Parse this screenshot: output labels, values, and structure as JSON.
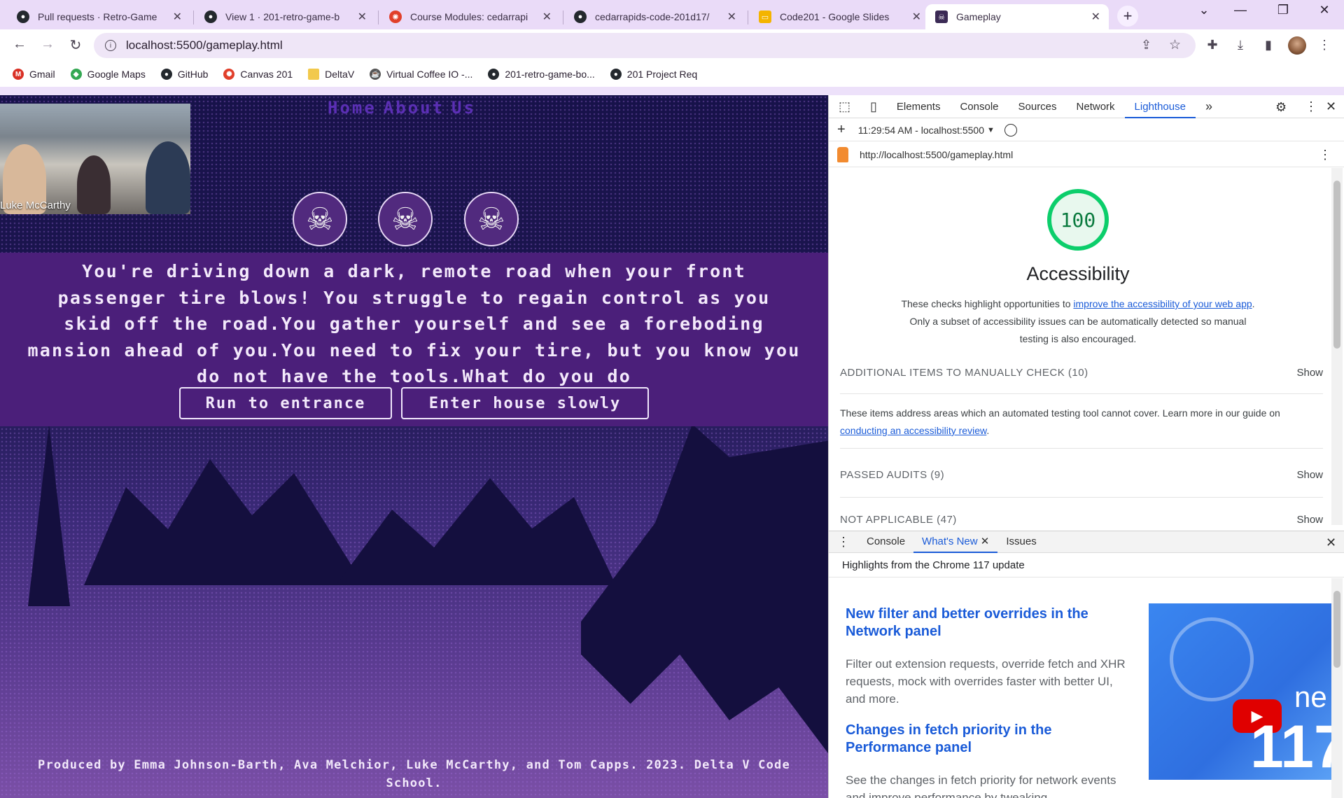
{
  "tabs": [
    {
      "title": "Pull requests · Retro-Game",
      "icon": "github-icon"
    },
    {
      "title": "View 1 · 201-retro-game-b",
      "icon": "github-icon"
    },
    {
      "title": "Course Modules: cedarrapi",
      "icon": "canvas-icon"
    },
    {
      "title": "cedarrapids-code-201d17/",
      "icon": "github-icon"
    },
    {
      "title": "Code201 - Google Slides",
      "icon": "slides-icon"
    },
    {
      "title": "Gameplay",
      "icon": "skull-icon"
    }
  ],
  "address_bar": {
    "url": "localhost:5500/gameplay.html"
  },
  "bookmarks": [
    {
      "label": "Gmail",
      "icon": "gmail-icon",
      "color": "#d93025"
    },
    {
      "label": "Google Maps",
      "icon": "maps-icon",
      "color": "#34a853"
    },
    {
      "label": "GitHub",
      "icon": "github-icon",
      "color": "#24292e"
    },
    {
      "label": "Canvas 201",
      "icon": "canvas-icon",
      "color": "#e13f2a"
    },
    {
      "label": "DeltaV",
      "icon": "folder-icon",
      "color": "#f2c94c"
    },
    {
      "label": "Virtual Coffee IO -...",
      "icon": "coffee-icon",
      "color": "#555555"
    },
    {
      "label": "201-retro-game-bo...",
      "icon": "github-icon",
      "color": "#24292e"
    },
    {
      "label": "201 Project Req",
      "icon": "github-icon",
      "color": "#24292e"
    }
  ],
  "page": {
    "nav": [
      "Home",
      "About",
      "Us"
    ],
    "story": "You're driving down a dark, remote road when your front\npassenger tire blows! You struggle to regain control as you\nskid off the road.You gather yourself and see a foreboding\nmansion ahead of you.You need to fix your tire, but you know you\ndo not have the tools.What do you do",
    "choices": [
      "Run to entrance",
      "Enter house slowly"
    ],
    "footer": "Produced by Emma Johnson-Barth, Ava Melchior, Luke McCarthy, and Tom Capps. 2023. Delta V Code\nSchool.",
    "video_name": "Luke McCarthy"
  },
  "devtools": {
    "tabs": [
      "Elements",
      "Console",
      "Sources",
      "Network",
      "Lighthouse"
    ],
    "active_tab": "Lighthouse",
    "report_time": "11:29:54 AM - localhost:5500",
    "report_url": "http://localhost:5500/gameplay.html",
    "score": "100",
    "category": "Accessibility",
    "desc_pre": "These checks highlight opportunities to ",
    "desc_link": "improve the accessibility of your web app",
    "desc_post": ". Only a subset of accessibility issues can be automatically detected so manual testing is also encouraged.",
    "manual_label": "ADDITIONAL ITEMS TO MANUALLY CHECK (10)",
    "show": "Show",
    "manual_desc_pre": "These items address areas which an automated testing tool cannot cover. Learn more in our guide on ",
    "manual_desc_link": "conducting an accessibility review",
    "manual_desc_post": ".",
    "passed_label": "PASSED AUDITS (9)",
    "na_label": "NOT APPLICABLE (47)",
    "drawer_tabs": [
      "Console",
      "What's New",
      "Issues"
    ],
    "drawer_head": "Highlights from the Chrome 117 update",
    "whats_new": [
      {
        "title": "New filter and better overrides in the Network panel",
        "body": "Filter out extension requests, override fetch and XHR requests, mock with overrides faster with better UI, and more."
      },
      {
        "title": "Changes in fetch priority in the Performance panel",
        "body": "See the changes in fetch priority for network events and improve performance by tweaking"
      }
    ],
    "video_text_1": "ne",
    "video_text_2": "117"
  },
  "colors": {
    "accent": "#1a5bd8",
    "score": "#0cce6b",
    "game_bg": "#4b1f7a",
    "nav_link": "#5b2fb5"
  }
}
